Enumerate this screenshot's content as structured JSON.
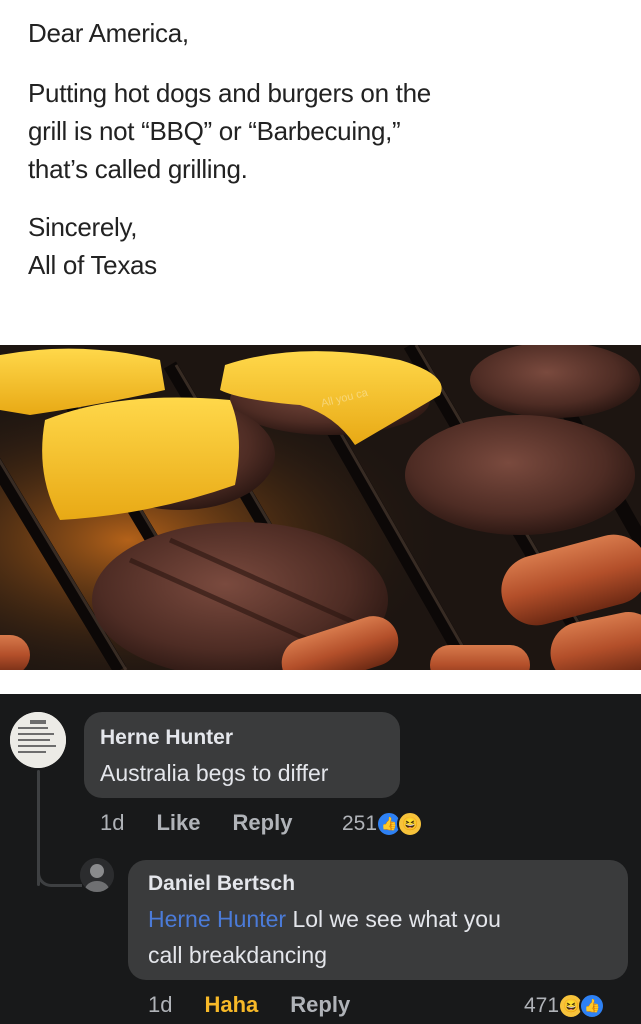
{
  "post": {
    "greeting": "Dear America,",
    "body_lines": [
      "Putting hot dogs and burgers on the",
      "grill is not “BBQ” or “Barbecuing,”",
      "that’s called grilling."
    ],
    "signoff_1": "Sincerely,",
    "signoff_2": "All of Texas",
    "image_watermark": "All you ca"
  },
  "comments": [
    {
      "author": "Herne Hunter",
      "text": "Australia begs to differ",
      "time": "1d",
      "actions": [
        "Like",
        "Reply"
      ],
      "reaction_count": "251",
      "reactions": [
        "like",
        "haha"
      ]
    },
    {
      "author": "Daniel Bertsch",
      "mention": "Herne Hunter",
      "text_line1": " Lol we see what you",
      "text_line2": "call breakdancing",
      "time": "1d",
      "actions": [
        "Haha",
        "Reply"
      ],
      "reaction_count": "471",
      "reactions": [
        "haha",
        "like"
      ]
    }
  ],
  "colors": {
    "bg_dark": "#18191a",
    "bubble": "#3a3b3c",
    "mention": "#4b7bd8",
    "haha": "#f7b928",
    "like": "#2e81f4"
  }
}
